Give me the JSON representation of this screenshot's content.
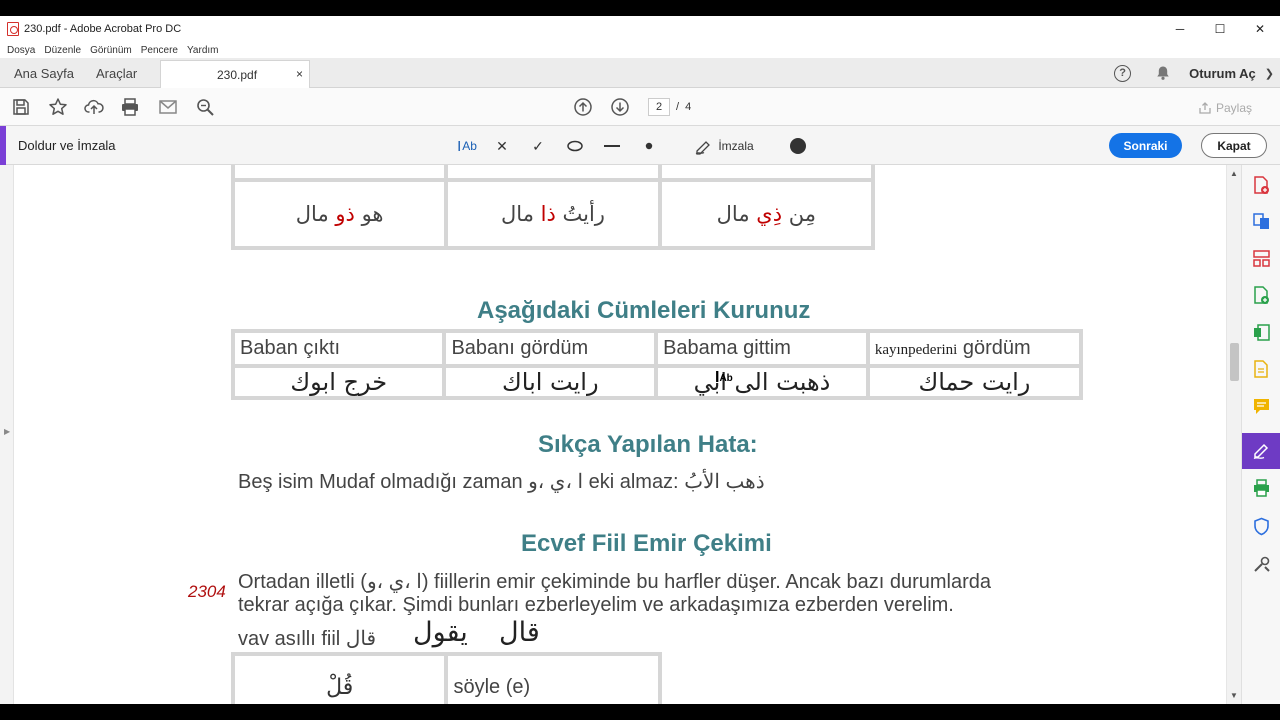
{
  "window": {
    "title": "230.pdf - Adobe Acrobat Pro DC",
    "controls": [
      "─",
      "☐",
      "✕"
    ]
  },
  "menu": [
    "Dosya",
    "Düzenle",
    "Görünüm",
    "Pencere",
    "Yardım"
  ],
  "tabs": {
    "home": "Ana Sayfa",
    "tools": "Araçlar",
    "document": "230.pdf",
    "close": "×",
    "signin": "Oturum Aç"
  },
  "toolbar": {
    "page_current": "2",
    "page_sep": "/",
    "page_total": "4",
    "share": "Paylaş"
  },
  "fill_sign": {
    "title": "Doldur ve İmzala",
    "text_tool": "Ab",
    "cross_tool": "✕",
    "check_tool": "✓",
    "sign_label": "İmzala",
    "next": "Sonraki",
    "close": "Kapat"
  },
  "doc": {
    "top_row": [
      "هو ذو مال",
      "رأيتُ ذا مال",
      "مِن ذِي مال"
    ],
    "heading1": "Aşağıdaki Cümleleri Kurunuz",
    "sentences_tr": [
      "Baban çıktı",
      "Babanı gördüm",
      "Babama gittim",
      "gördüm"
    ],
    "annotation_text": "kayınpederini",
    "sentences_ar": [
      "خرج ابوك",
      "رايت اباك",
      "ذهبت الى ابي",
      "رايت حماك"
    ],
    "text_cursor": "Ab",
    "heading2": "Sıkça Yapılan Hata:",
    "mistake": "Beş isim Mudaf olmadığı zaman ا ،ي ،و eki almaz: ذهب الأبُ",
    "heading3": "Ecvef Fiil Emir Çekimi",
    "page_number": "2304",
    "para1": "Ortadan illetli (ا ،ي ،و) fiillerin emir çekiminde bu harfler düşer. Ancak bazı durumlarda",
    "para2": "tekrar açığa çıkar. Şimdi bunları ezberleyelim ve arkadaşımıza ezberden verelim.",
    "vav_label": "vav asıllı fiil قال",
    "verb1": "يقول",
    "verb2": "قال",
    "imperative_ar": "قُلْ",
    "imperative_tr": "söyle (e)"
  },
  "colors": {
    "heading": "#3f7f87",
    "accent_purple": "#7a3fd6",
    "next_button": "#1473e6",
    "highlight_red": "#c00000"
  }
}
